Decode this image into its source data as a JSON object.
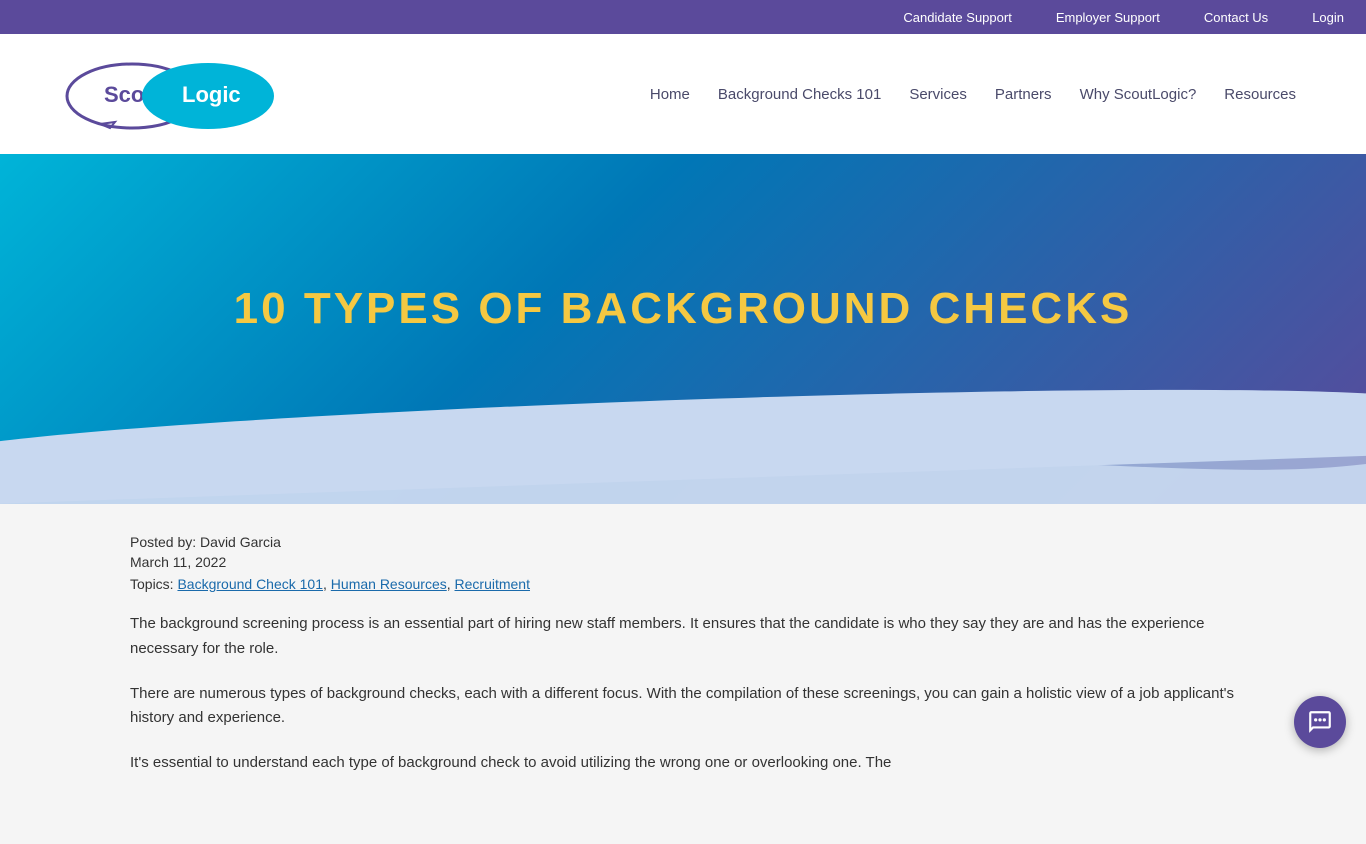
{
  "topbar": {
    "links": [
      {
        "label": "Candidate Support",
        "name": "candidate-support-link"
      },
      {
        "label": "Employer Support",
        "name": "employer-support-link"
      },
      {
        "label": "Contact Us",
        "name": "contact-us-link"
      },
      {
        "label": "Login",
        "name": "login-link"
      }
    ]
  },
  "header": {
    "logo_text_scout": "Scout",
    "logo_text_logic": "Logic",
    "nav": [
      {
        "label": "Home",
        "name": "nav-home"
      },
      {
        "label": "Background Checks 101",
        "name": "nav-bg-checks"
      },
      {
        "label": "Services",
        "name": "nav-services"
      },
      {
        "label": "Partners",
        "name": "nav-partners"
      },
      {
        "label": "Why ScoutLogic?",
        "name": "nav-why"
      },
      {
        "label": "Resources",
        "name": "nav-resources"
      }
    ]
  },
  "hero": {
    "title": "10 TYPES OF BACKGROUND CHECKS"
  },
  "article": {
    "posted_by": "Posted by: David Garcia",
    "date": "March 11, 2022",
    "topics_label": "Topics:",
    "topics": [
      {
        "label": "Background Check 101",
        "name": "topic-bg101"
      },
      {
        "label": "Human Resources",
        "name": "topic-hr"
      },
      {
        "label": "Recruitment",
        "name": "topic-recruitment"
      }
    ],
    "paragraphs": [
      "The background screening process is an essential part of hiring new staff members. It ensures that the candidate is who they say they are and has the experience necessary for the role.",
      "There are numerous types of background checks, each with a different focus. With the compilation of these screenings, you can gain a holistic view of a job applicant's history and experience.",
      "It's essential to understand each type of background check to avoid utilizing the wrong one or overlooking one. The"
    ]
  },
  "chat": {
    "label": "Chat Support"
  }
}
